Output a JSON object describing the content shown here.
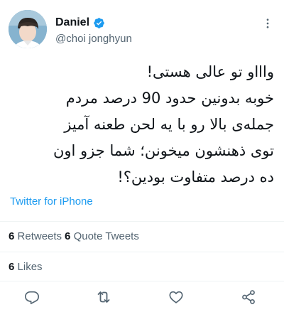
{
  "author": {
    "display_name": "Daniel",
    "handle": "@choi jonghyun",
    "verified": true
  },
  "tweet": {
    "text": "واااو تو عالی هستی!\nخوبه بدونین حدود 90 درصد مردم\nجمله‌ی بالا رو با یه لحن طعنه آمیز\nتوی ذهنشون میخونن؛ شما جزو اون\nده درصد متفاوت بودین؟!",
    "source": "Twitter for iPhone"
  },
  "stats": {
    "retweets_count": "6",
    "retweets_label": "Retweets",
    "quote_tweets_count": "6",
    "quote_tweets_label": "Quote Tweets",
    "likes_count": "6",
    "likes_label": "Likes"
  },
  "actions": {
    "reply_icon": "reply-icon",
    "retweet_icon": "retweet-icon",
    "like_icon": "like-icon",
    "share_icon": "share-icon"
  },
  "colors": {
    "accent": "#1d9bf0",
    "text_primary": "#0f1419",
    "text_secondary": "#536471",
    "divider": "#eff3f4"
  }
}
